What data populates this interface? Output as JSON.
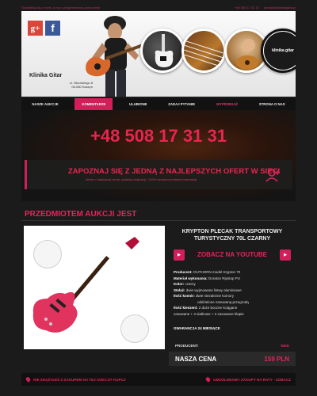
{
  "top_strip": {
    "left": "Skontaktuj się z nami, a my z przyjemnością pomożemy",
    "right_phone": "+48 508 17 31 31",
    "right_email": "kontakt@klinikagitar.pl"
  },
  "header": {
    "social": [
      "g+",
      "f"
    ],
    "shop_name": "Klinika Gitar",
    "address": [
      "ul. Sikorskiego 8",
      "05-080 Kaszyn"
    ],
    "logo_text": "klinika gitar"
  },
  "nav": {
    "items": [
      {
        "label": "NASZE AUKCJE",
        "state": "normal"
      },
      {
        "label": "KOMENTARZE",
        "state": "active"
      },
      {
        "label": "ULUBIONE",
        "state": "normal"
      },
      {
        "label": "ZADAJ PYTANIE",
        "state": "normal"
      },
      {
        "label": "WYPRZEDAŻ",
        "state": "pink"
      },
      {
        "label": "STRONA O NAS",
        "state": "normal"
      }
    ]
  },
  "phone": "+48 508 17 31 31",
  "promo": {
    "title": "ZAPOZNAJ SIĘ Z JEDNĄ Z NAJLEPSZYCH OFERT W SIECI",
    "subtitle": "oferta o najniższej cenie, szybkiej realizacji i 100% bezpieczeństwem transakcji"
  },
  "section_title": "PRZEDMIOTEM AUKCJI JEST",
  "product": {
    "title": "KRYPTON PLECAK TRANSPORTOWY TURYSTYCZNY 70L CZARNY",
    "youtube_label": "ZOBACZ NA YOUTUBE",
    "specs": [
      {
        "k": "Producent:",
        "v": "OUTHORN model Krypton 70"
      },
      {
        "k": "Materiał wykonania:",
        "v": "Duraton Ripstop PU"
      },
      {
        "k": "Kolor:",
        "v": "czarny"
      },
      {
        "k": "Stelaż:",
        "v": "dwie wyjmowane listwy aluminiowe"
      },
      {
        "k": "Ilość komór:",
        "v": "dwie niezależne komory"
      },
      {
        "k": "",
        "v": "oddzielone zasuwaną przegrodą"
      },
      {
        "k": "Ilość kieszeni:",
        "v": "2 duże boczne ściągane"
      },
      {
        "k": "",
        "v": "zasuwane + 3 siatkowe + 3 zasuwane klapie"
      }
    ],
    "guarantee": "GWARANCJA 24 MIESIĄCE",
    "producer_label": "PRODUCENT:",
    "producer_value": "NIKE",
    "price_label": "NASZA CENA",
    "price_value": "159 PLN"
  },
  "bottom": {
    "left": "NIE ZDĄŻYŁEŚ Z ZAKUPEM NA TEJ AUKCJI? KUPUJ",
    "right": "UMOŻLIWIAMY ZAKUPY NA RATY - ZOBACZ"
  }
}
